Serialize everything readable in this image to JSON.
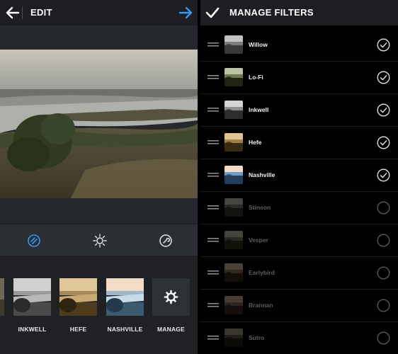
{
  "edit_screen": {
    "title": "EDIT",
    "back_icon": "arrow-left-icon",
    "next_icon": "arrow-right-icon",
    "accent_color": "#3897f0",
    "tools": [
      {
        "name": "filter-tool",
        "icon": "filter-icon",
        "active": true
      },
      {
        "name": "lux-tool",
        "icon": "brightness-icon",
        "active": false
      },
      {
        "name": "adjust-tool",
        "icon": "wrench-icon",
        "active": false
      }
    ],
    "filter_strip": [
      {
        "label": "INKWELL"
      },
      {
        "label": "HEFE"
      },
      {
        "label": "NASHVILLE"
      },
      {
        "label": "MANAGE",
        "icon": "gear-icon"
      }
    ]
  },
  "manage_screen": {
    "title": "MANAGE FILTERS",
    "done_icon": "checkmark-icon",
    "filters": [
      {
        "name": "Willow",
        "enabled": true
      },
      {
        "name": "Lo-Fi",
        "enabled": true
      },
      {
        "name": "Inkwell",
        "enabled": true
      },
      {
        "name": "Hefe",
        "enabled": true
      },
      {
        "name": "Nashville",
        "enabled": true
      },
      {
        "name": "Stinson",
        "enabled": false
      },
      {
        "name": "Vesper",
        "enabled": false
      },
      {
        "name": "Earlybird",
        "enabled": false
      },
      {
        "name": "Brannan",
        "enabled": false
      },
      {
        "name": "Sutro",
        "enabled": false
      }
    ]
  }
}
